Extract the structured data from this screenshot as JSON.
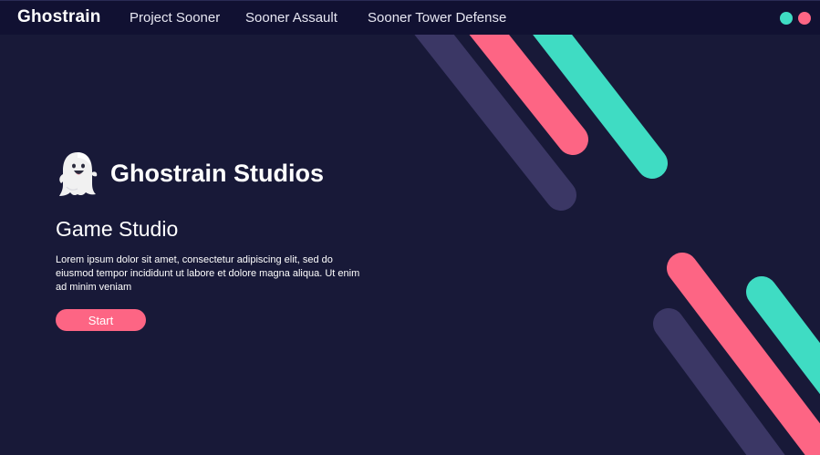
{
  "navbar": {
    "brand": "Ghostrain",
    "links": [
      "Project Sooner",
      "Sooner Assault",
      "Sooner Tower Defense"
    ],
    "theme_dots": [
      "#3fdcc3",
      "#fd6584"
    ]
  },
  "hero": {
    "icon": "ghost-icon",
    "title": "Ghostrain Studios",
    "subtitle": "Game Studio",
    "text": "Lorem ipsum dolor sit amet, consectetur adipiscing elit, sed do eiusmod tempor incididunt ut labore et dolore magna aliqua. Ut enim ad minim veniam",
    "button_label": "Start"
  },
  "colors": {
    "background": "#181938",
    "navbar": "#111132",
    "accent_pink": "#fd6584",
    "accent_teal": "#3fdcc3",
    "stripe_purple": "#3b3765"
  }
}
